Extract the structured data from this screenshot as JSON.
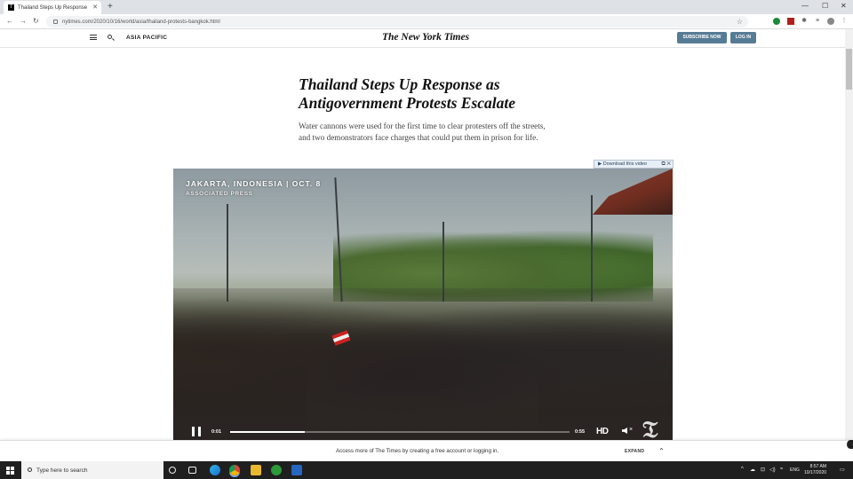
{
  "browser": {
    "tab_title": "Thailand Steps Up Response",
    "favicon_letter": "T",
    "url": "nytimes.com/2020/10/16/world/asia/thailand-protests-bangkok.html"
  },
  "header": {
    "section": "ASIA PACIFIC",
    "logo": "The New York Times",
    "subscribe_label": "SUBSCRIBE NOW",
    "login_label": "LOG IN"
  },
  "article": {
    "headline": "Thailand Steps Up Response as Antigovernment Protests Escalate",
    "summary": "Water cannons were used for the first time to clear protesters off the streets, and two demonstrators face charges that could put them in prison for life."
  },
  "download_bar": {
    "label": "Download this video"
  },
  "video": {
    "location": "JAKARTA, INDONESIA  |  OCT. 8",
    "credit": "ASSOCIATED PRESS",
    "current_time": "0:01",
    "duration": "0:55",
    "progress_fraction": 0.22,
    "hd_label": "HD"
  },
  "bottom_bar": {
    "message": "Access more of The Times by creating a free account or logging in.",
    "expand_label": "EXPAND"
  },
  "taskbar": {
    "search_placeholder": "Type here to search",
    "language": "ENG",
    "time": "8:57 AM",
    "date": "10/17/2020"
  },
  "colors": {
    "accent_button": "#567b95",
    "taskbar": "#1f1f1f"
  }
}
